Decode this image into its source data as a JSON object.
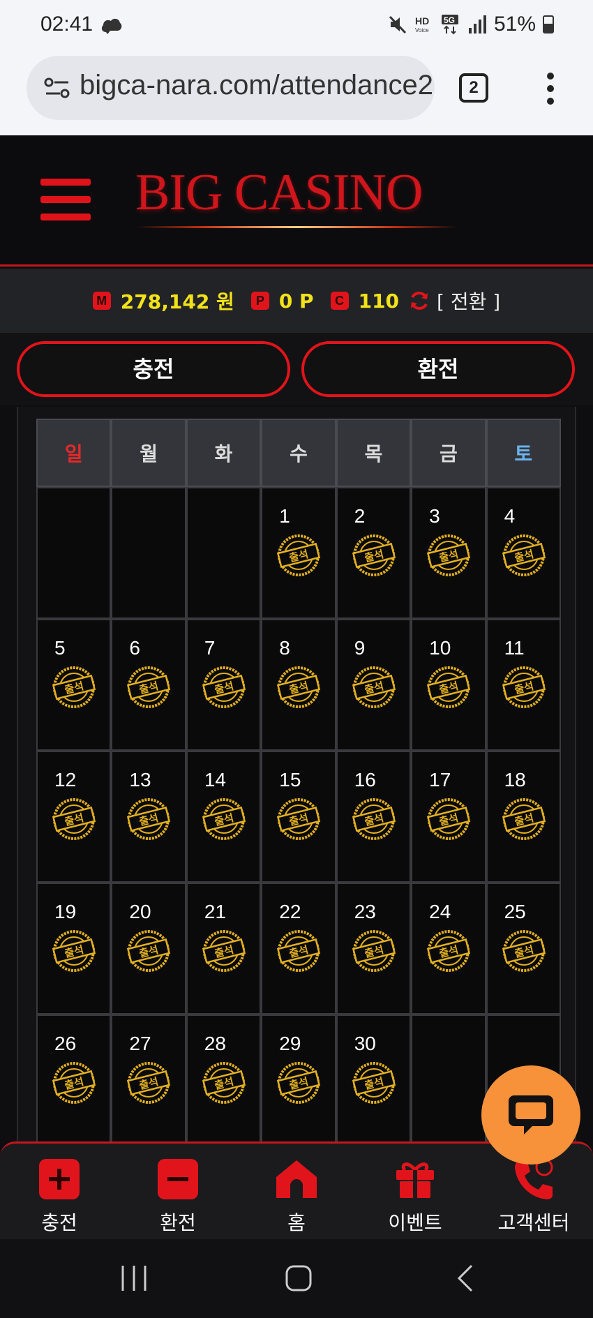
{
  "status_bar": {
    "time": "02:41",
    "battery": "51%",
    "icons": [
      "mute-icon",
      "hd-voice-icon",
      "5g-icon",
      "signal-icon",
      "battery-icon"
    ]
  },
  "browser": {
    "url": "bigca-nara.com/attendance2",
    "tab_count": "2"
  },
  "header": {
    "logo": "BIG CASINO"
  },
  "balance": {
    "money_badge": "M",
    "money": "278,142 원",
    "point_badge": "P",
    "point": "0 P",
    "coin_badge": "C",
    "coin": "110",
    "swap_label": "[ 전환 ]"
  },
  "actions": {
    "charge": "충전",
    "exchange": "환전"
  },
  "calendar": {
    "weekdays": [
      "일",
      "월",
      "화",
      "수",
      "목",
      "금",
      "토"
    ],
    "leading_blanks": 3,
    "days": [
      "1",
      "2",
      "3",
      "4",
      "5",
      "6",
      "7",
      "8",
      "9",
      "10",
      "11",
      "12",
      "13",
      "14",
      "15",
      "16",
      "17",
      "18",
      "19",
      "20",
      "21",
      "22",
      "23",
      "24",
      "25",
      "26",
      "27",
      "28",
      "29",
      "30"
    ],
    "stamp_text": "출석",
    "colors": {
      "sunday": "#e52a2a",
      "saturday": "#6cb4ee",
      "stamp": "#e2b020"
    }
  },
  "bottom_nav": {
    "items": [
      {
        "label": "충전",
        "icon": "plus-icon"
      },
      {
        "label": "환전",
        "icon": "minus-icon"
      },
      {
        "label": "홈",
        "icon": "home-icon"
      },
      {
        "label": "이벤트",
        "icon": "gift-icon"
      },
      {
        "label": "고객센터",
        "icon": "phone-icon"
      }
    ]
  },
  "accent": "#e0141a"
}
